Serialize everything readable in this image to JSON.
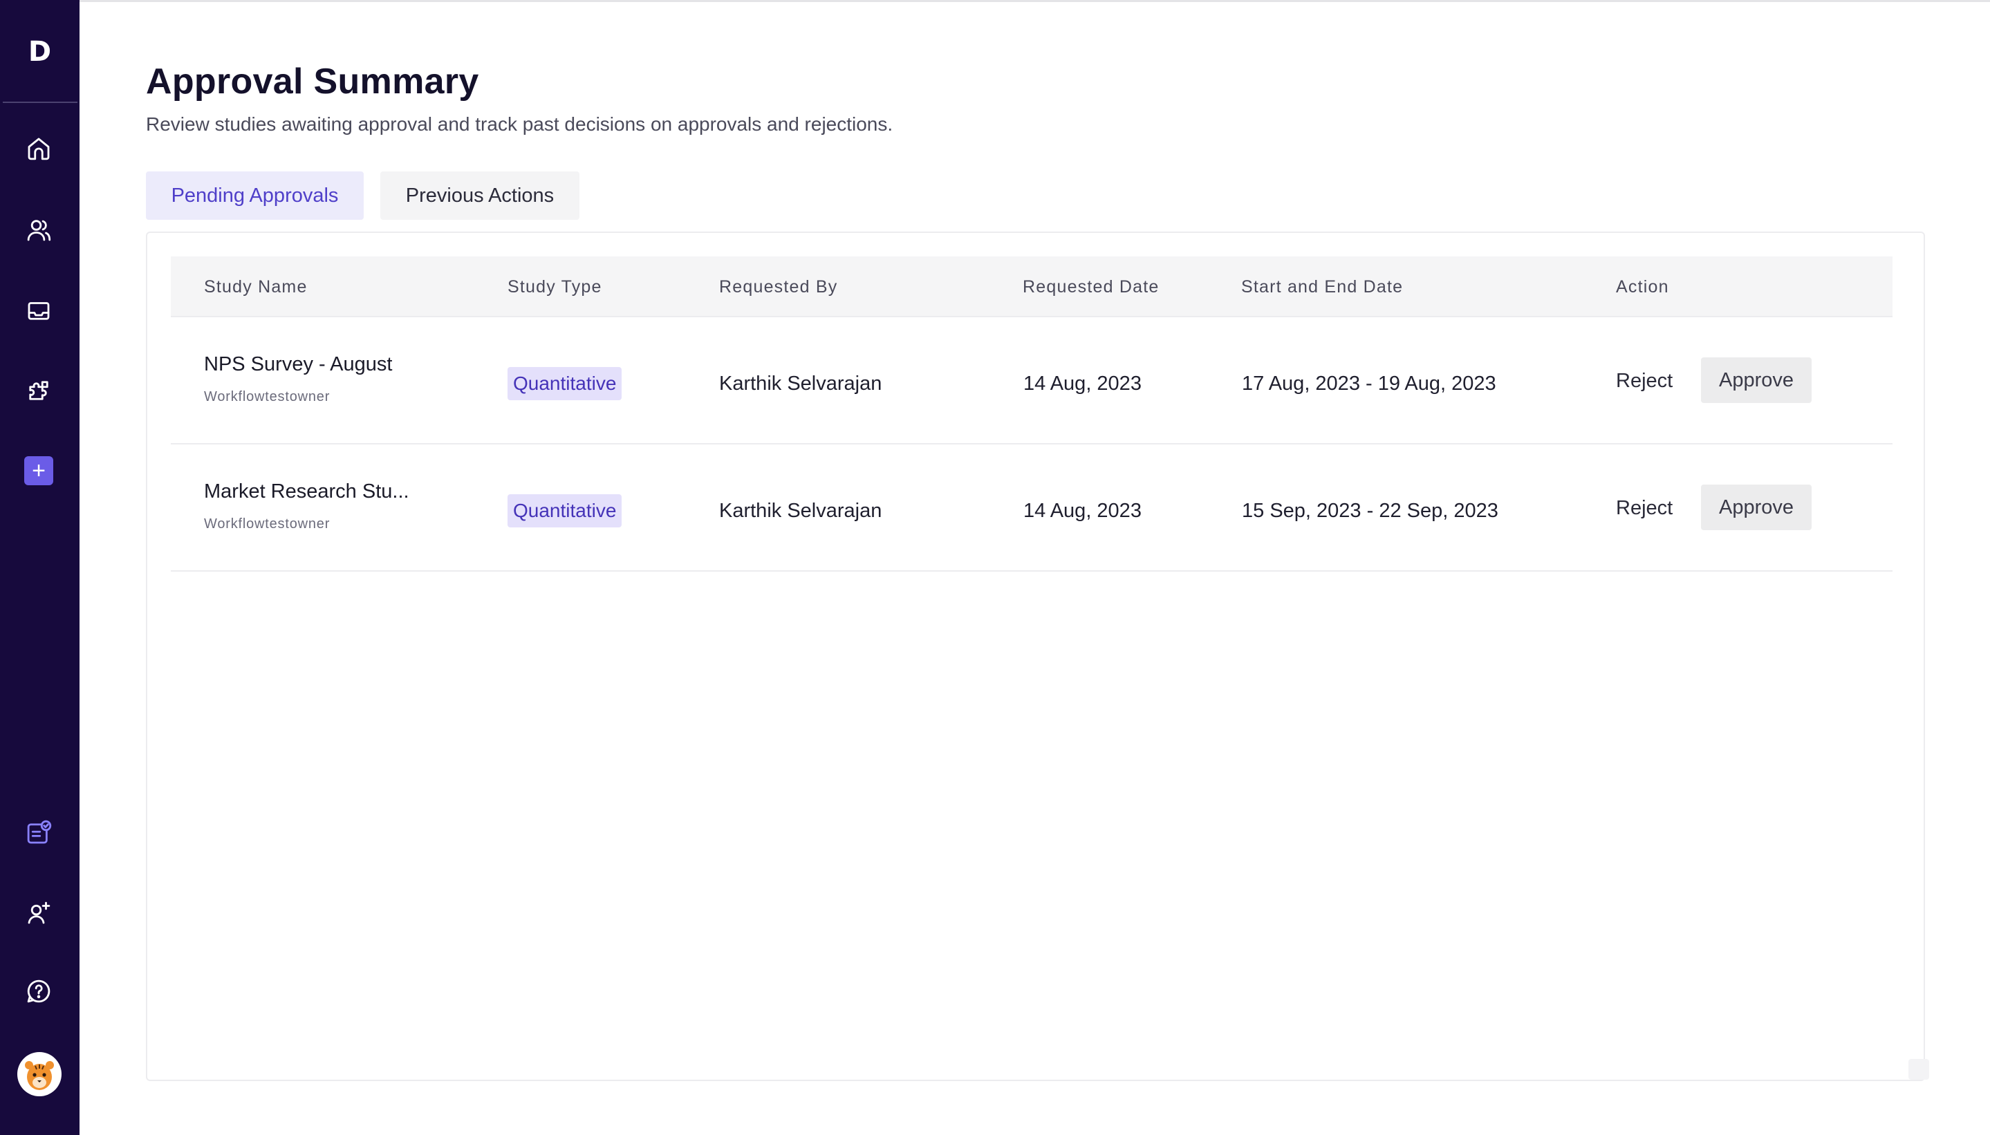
{
  "app": {
    "logo_letter": "D"
  },
  "sidebar": {
    "top_items": [
      {
        "icon": "home-icon"
      },
      {
        "icon": "users-icon"
      },
      {
        "icon": "inbox-icon"
      },
      {
        "icon": "puzzle-icon"
      },
      {
        "icon": "plus-icon",
        "label": "+"
      }
    ],
    "bottom_items": [
      {
        "icon": "approval-checklist-icon"
      },
      {
        "icon": "add-user-icon"
      },
      {
        "icon": "help-icon"
      },
      {
        "icon": "avatar"
      }
    ]
  },
  "header": {
    "title": "Approval Summary",
    "subtitle": "Review studies awaiting approval and track past decisions on approvals and rejections."
  },
  "tabs": [
    {
      "label": "Pending Approvals",
      "active": true
    },
    {
      "label": "Previous Actions",
      "active": false
    }
  ],
  "table": {
    "columns": [
      "Study Name",
      "Study Type",
      "Requested By",
      "Requested Date",
      "Start and End Date",
      "Action"
    ],
    "rows": [
      {
        "study_name": "NPS Survey - August",
        "owner": "Workflowtestowner",
        "study_type": "Quantitative",
        "requested_by": "Karthik Selvarajan",
        "requested_date": "14 Aug, 2023",
        "date_range": "17 Aug, 2023 - 19 Aug, 2023",
        "reject_label": "Reject",
        "approve_label": "Approve"
      },
      {
        "study_name": "Market Research Stu...",
        "owner": "Workflowtestowner",
        "study_type": "Quantitative",
        "requested_by": "Karthik Selvarajan",
        "requested_date": "14 Aug, 2023",
        "date_range": "15 Sep, 2023 - 22 Sep, 2023",
        "reject_label": "Reject",
        "approve_label": "Approve"
      }
    ]
  },
  "colors": {
    "sidebar_bg": "#170a3d",
    "accent": "#6b5ce7",
    "tab_active_bg": "#ecebfb",
    "tab_active_text": "#4f3fc9",
    "badge_bg": "#e4e0fb",
    "badge_text": "#4533b8"
  }
}
